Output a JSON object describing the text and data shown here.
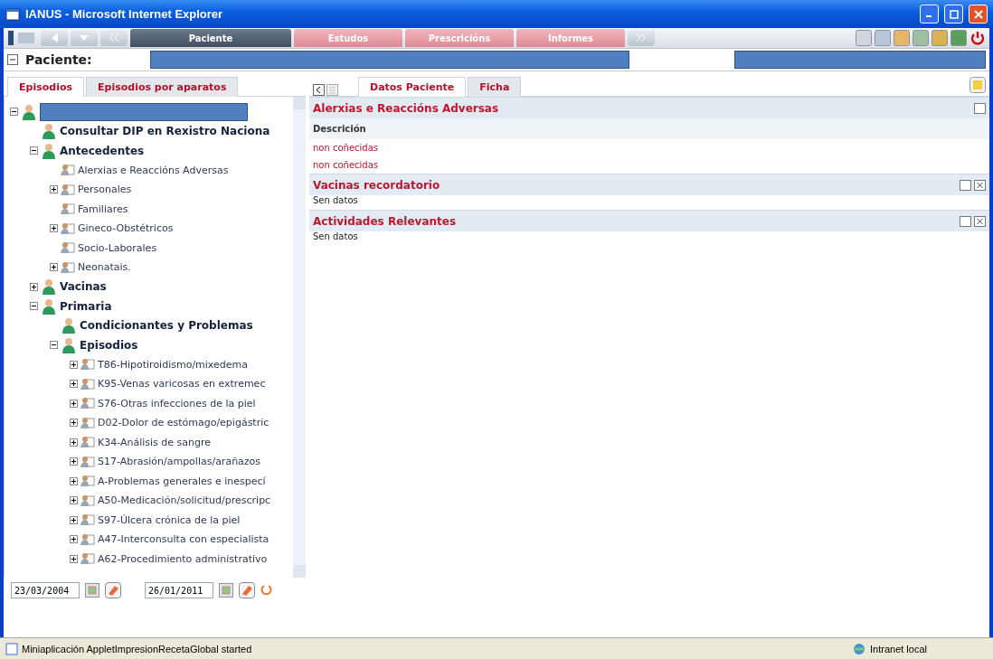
{
  "window": {
    "title": "IANUS - Microsoft Internet Explorer"
  },
  "nav_tabs": [
    {
      "label": "Paciente",
      "selected": true
    },
    {
      "label": "Estudos",
      "selected": false
    },
    {
      "label": "Prescricións",
      "selected": false
    },
    {
      "label": "Informes",
      "selected": false
    }
  ],
  "patient_bar": {
    "label": "Paciente:"
  },
  "left_tabs": [
    {
      "label": "Episodios",
      "selected": true
    },
    {
      "label": "Episodios por aparatos",
      "selected": false
    }
  ],
  "tree": [
    {
      "kind": "heading",
      "expanded": true,
      "children": [
        {
          "kind": "heading",
          "label": "Consultar DIP en Rexistro Naciona"
        },
        {
          "kind": "heading",
          "label": "Antecedentes",
          "expanded": true,
          "children": [
            {
              "kind": "item",
              "label": "Alerxias e Reaccións Adversas"
            },
            {
              "kind": "item",
              "label": "Personales",
              "expanded": false
            },
            {
              "kind": "item",
              "label": "Familiares"
            },
            {
              "kind": "item",
              "label": "Gineco-Obstétricos",
              "expanded": false
            },
            {
              "kind": "item",
              "label": "Socio-Laborales"
            },
            {
              "kind": "item",
              "label": "Neonatais.",
              "expanded": false
            }
          ]
        },
        {
          "kind": "heading",
          "label": "Vacinas",
          "expanded": false
        },
        {
          "kind": "heading",
          "label": "Primaria",
          "expanded": true,
          "children": [
            {
              "kind": "heading",
              "label": "Condicionantes y Problemas"
            },
            {
              "kind": "heading",
              "label": "Episodios",
              "expanded": true,
              "children": [
                {
                  "kind": "item",
                  "label": "T86-Hipotiroidismo/mixedema",
                  "expanded": false
                },
                {
                  "kind": "item",
                  "label": "K95-Venas varicosas en extremec",
                  "expanded": false
                },
                {
                  "kind": "item",
                  "label": "S76-Otras infecciones de la piel",
                  "expanded": false
                },
                {
                  "kind": "item",
                  "label": "D02-Dolor de estómago/epigástric",
                  "expanded": false
                },
                {
                  "kind": "item",
                  "label": "K34-Análisis de sangre",
                  "expanded": false
                },
                {
                  "kind": "item",
                  "label": "S17-Abrasión/ampollas/arañazos",
                  "expanded": false
                },
                {
                  "kind": "item",
                  "label": "A-Problemas generales e inespecí",
                  "expanded": false
                },
                {
                  "kind": "item",
                  "label": "A50-Medicación/solicitud/prescripc",
                  "expanded": false
                },
                {
                  "kind": "item",
                  "label": "S97-Úlcera crónica de la piel",
                  "expanded": false
                },
                {
                  "kind": "item",
                  "label": "A47-Interconsulta con especialista",
                  "expanded": false
                },
                {
                  "kind": "item",
                  "label": "A62-Procedimiento administrativo",
                  "expanded": false
                }
              ]
            }
          ]
        }
      ]
    }
  ],
  "date_from": "23/03/2004",
  "date_to": "26/01/2011",
  "right_tabs": [
    {
      "label": "Datos Paciente",
      "selected": true
    },
    {
      "label": "Ficha",
      "selected": false
    }
  ],
  "sections": [
    {
      "title": "Alerxias e Reaccións Adversas",
      "closable": false,
      "column": "Descrición",
      "rows": [
        "non coñecidas",
        "non coñecidas"
      ]
    },
    {
      "title": "Vacinas recordatorio",
      "closable": true,
      "empty_text": "Sen datos"
    },
    {
      "title": "Actividades Relevantes",
      "closable": true,
      "empty_text": "Sen datos"
    }
  ],
  "status_bar": {
    "message": "Miniaplicación AppletImpresionRecetaGlobal started",
    "zone": "Intranet local"
  }
}
